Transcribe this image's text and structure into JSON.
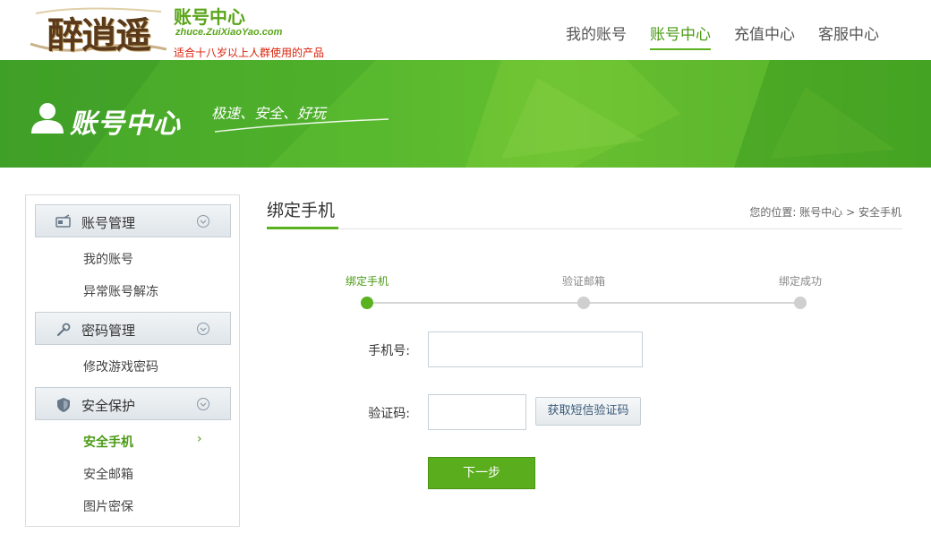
{
  "header": {
    "logo_text": "醉逍遥",
    "site_name": "账号中心",
    "domain": "zhuce.ZuiXiaoYao.com",
    "notice": "适合十八岁以上人群使用的产品",
    "nav": [
      {
        "label": "我的账号",
        "active": false
      },
      {
        "label": "账号中心",
        "active": true
      },
      {
        "label": "充值中心",
        "active": false
      },
      {
        "label": "客服中心",
        "active": false
      }
    ]
  },
  "banner": {
    "title": "账号中心",
    "slogan": "极速、安全、好玩"
  },
  "sidebar": {
    "groups": [
      {
        "label": "账号管理",
        "icon": "id-card-icon",
        "items": [
          "我的账号",
          "异常账号解冻"
        ]
      },
      {
        "label": "密码管理",
        "icon": "wrench-icon",
        "items": [
          "修改游戏密码"
        ]
      },
      {
        "label": "安全保护",
        "icon": "shield-icon",
        "items": [
          "安全手机",
          "安全邮箱",
          "图片密保"
        ]
      }
    ],
    "active_item": "安全手机",
    "active_arrow": "›"
  },
  "main": {
    "title": "绑定手机",
    "breadcrumb": {
      "prefix": "您的位置:",
      "home": "账号中心",
      "separator": ">",
      "current": "安全手机"
    },
    "steps": [
      {
        "label": "绑定手机",
        "active": true
      },
      {
        "label": "验证邮箱",
        "active": false
      },
      {
        "label": "绑定成功",
        "active": false
      }
    ],
    "form": {
      "phone_label": "手机号:",
      "phone_value": "",
      "code_label": "验证码:",
      "code_value": "",
      "sms_button": "获取短信验证码",
      "next_button": "下一步"
    }
  },
  "colors": {
    "accent": "#5ab220",
    "nav_active": "#4a9a14",
    "notice_red": "#d81e06",
    "banner_green": "#55b52c"
  }
}
